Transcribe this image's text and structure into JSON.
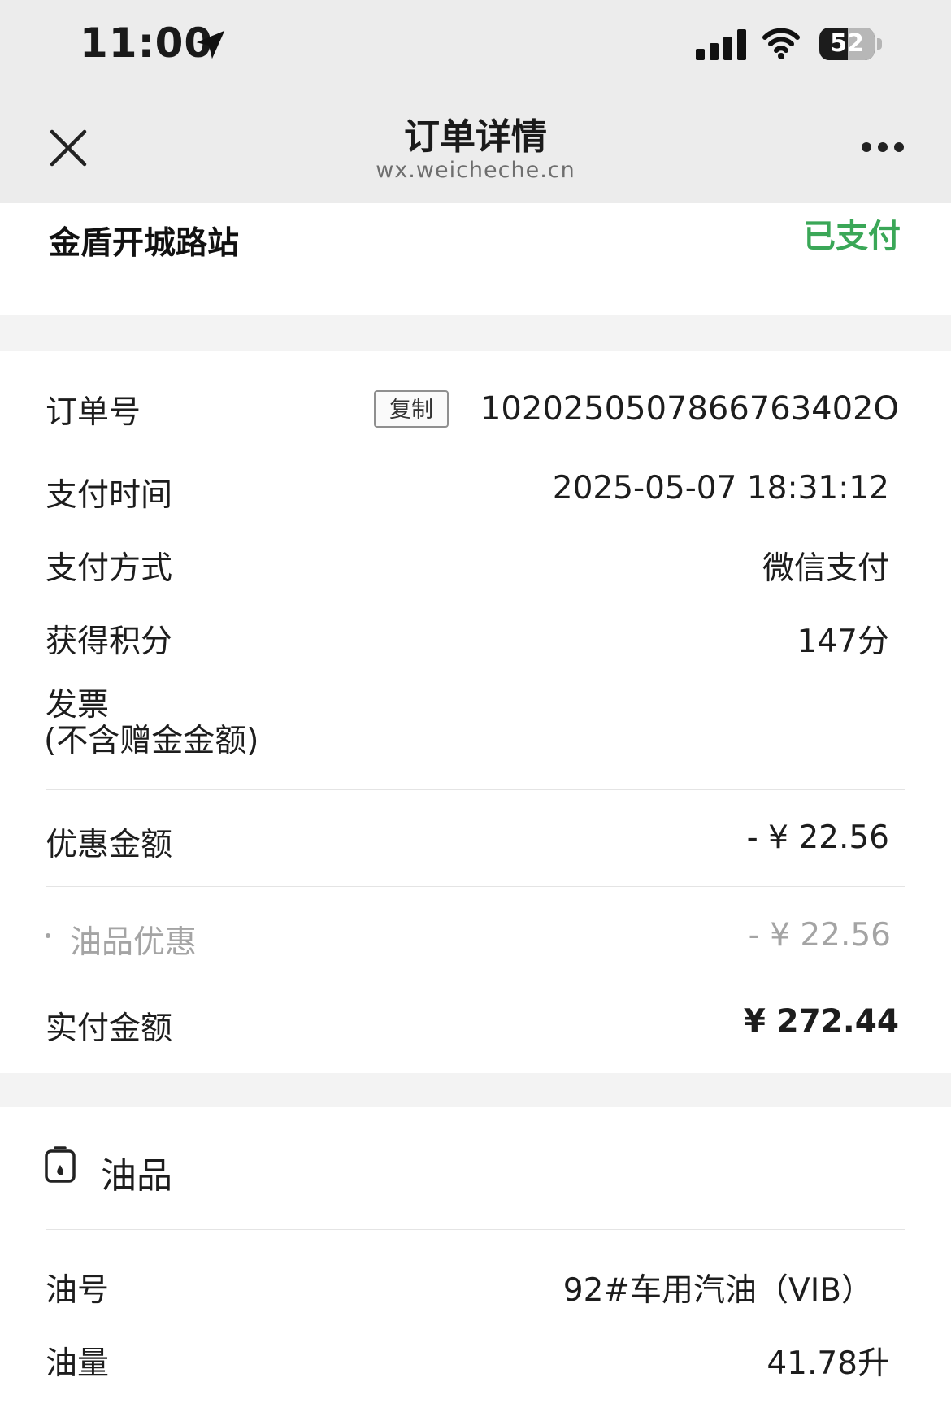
{
  "status_bar": {
    "time": "11:00",
    "battery": "52",
    "battery_level_percent": 52
  },
  "nav": {
    "title": "订单详情",
    "subtitle": "wx.weicheche.cn"
  },
  "station": {
    "name": "金盾开城路站",
    "status": "已支付",
    "status_color": "#3aa757"
  },
  "order": {
    "order_no_label": "订单号",
    "copy_label": "复制",
    "order_no": "1020250507866763402O",
    "pay_time_label": "支付时间",
    "pay_time": "2025-05-07 18:31:12",
    "pay_method_label": "支付方式",
    "pay_method": "微信支付",
    "points_label": "获得积分",
    "points": "147分",
    "invoice_label": "发票",
    "invoice_note": "(不含赠金金额)"
  },
  "amounts": {
    "discount_label": "优惠金额",
    "discount_value": "- ¥ 22.56",
    "fuel_discount_label": "油品优惠",
    "fuel_discount_value": "-  ¥ 22.56",
    "paid_label": "实付金额",
    "paid_value": "¥ 272.44"
  },
  "fuel": {
    "section_title": "油品",
    "type_label": "油号",
    "type_value": "92#车用汽油（VIB）",
    "volume_label": "油量",
    "volume_value": "41.78升"
  }
}
